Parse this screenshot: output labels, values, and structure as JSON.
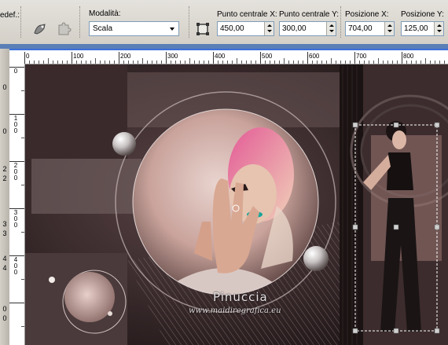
{
  "toolbar": {
    "preset_label": "edef.:",
    "mode_label": "Modalità:",
    "mode_value": "Scala",
    "center_x_label": "Punto centrale X:",
    "center_x_value": "450,00",
    "center_y_label": "Punto centrale Y:",
    "center_y_value": "300,00",
    "pos_x_label": "Posizione X:",
    "pos_x_value": "704,00",
    "pos_y_label": "Posizione Y:",
    "pos_y_value": "125,00"
  },
  "ruler_top": [
    "0",
    "100",
    "200",
    "300",
    "400",
    "500",
    "600",
    "700",
    "800"
  ],
  "ruler_left": [
    "0",
    "1 0 0",
    "2 0 0",
    "3 0 0",
    "4 0 0"
  ],
  "left_panel": [
    "0",
    "0",
    "2",
    "2",
    "3",
    "3",
    "4",
    "4",
    "0",
    "0"
  ],
  "artwork": {
    "signature": "Pinuccia",
    "website": "www.maidiregrafica.eu"
  },
  "colors": {
    "canvas_bg": "#2a1e1f",
    "accent_teal": "#1aa59a",
    "selection_blue": "#3b70d8"
  },
  "icons": [
    "pick-tool-icon",
    "puzzle-icon",
    "transform-box-icon"
  ]
}
